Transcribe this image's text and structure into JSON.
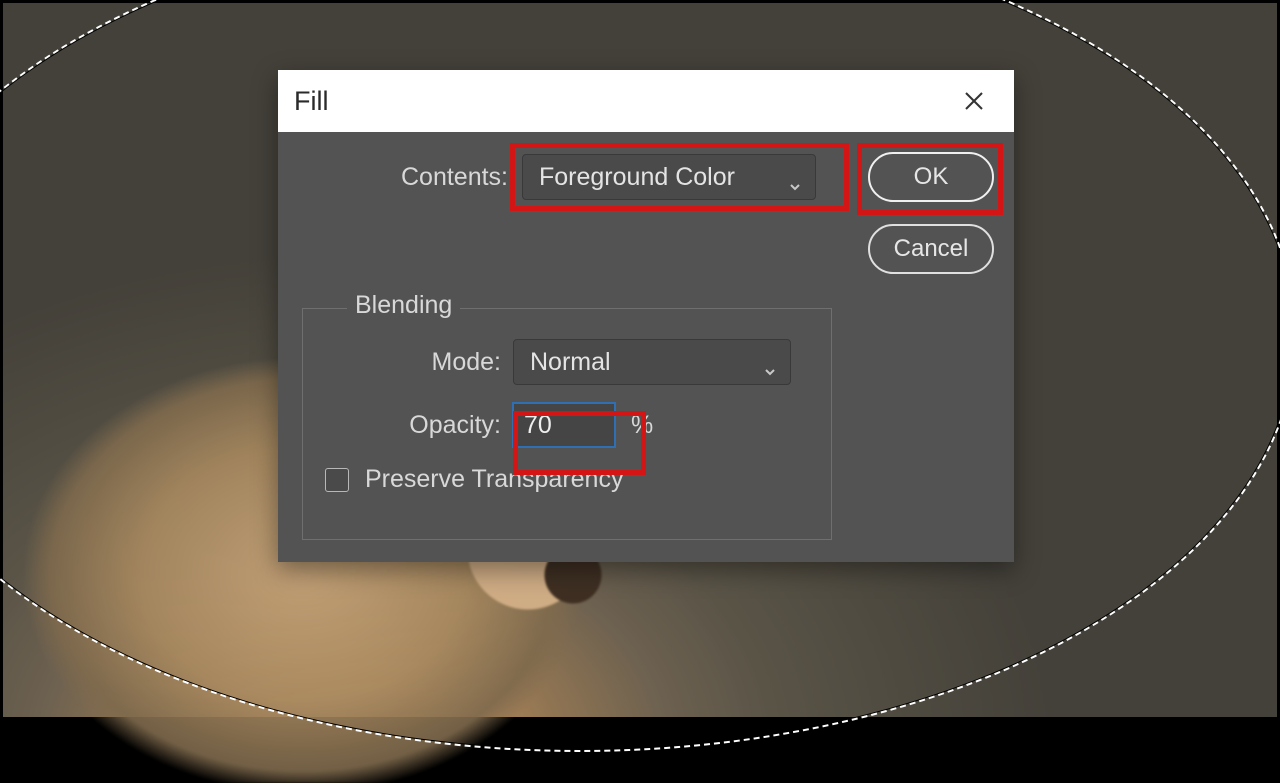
{
  "dialog": {
    "title": "Fill",
    "contents_label": "Contents:",
    "contents_value": "Foreground Color",
    "ok_label": "OK",
    "cancel_label": "Cancel",
    "blending": {
      "legend": "Blending",
      "mode_label": "Mode:",
      "mode_value": "Normal",
      "opacity_label": "Opacity:",
      "opacity_value": "70",
      "opacity_unit": "%",
      "preserve_label": "Preserve Transparency",
      "preserve_checked": false
    }
  },
  "highlights": [
    "contents-dropdown",
    "ok-button",
    "opacity-input"
  ]
}
